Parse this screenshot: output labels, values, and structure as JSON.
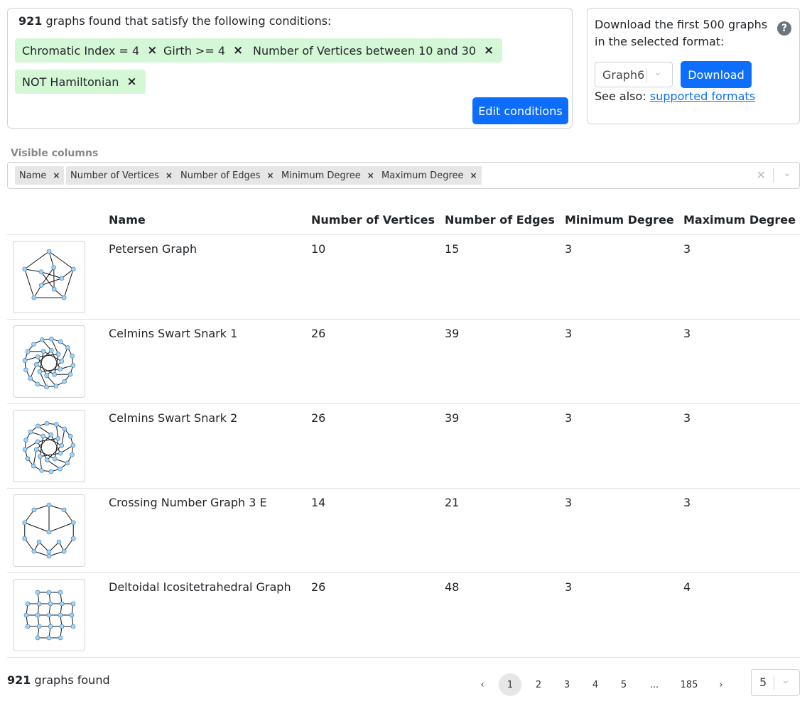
{
  "conditions": {
    "count": "921",
    "summary_suffix": "graphs found that satisfy the following conditions:",
    "chips": [
      {
        "label": "Chromatic Index = 4",
        "remove": "×"
      },
      {
        "label": "Girth >= 4",
        "remove": "×"
      },
      {
        "label": "Number of Vertices between 10 and 30",
        "remove": "×"
      },
      {
        "label": "NOT Hamiltonian",
        "remove": "×"
      }
    ],
    "edit_label": "Edit conditions"
  },
  "download": {
    "text": "Download the first 500 graphs in the selected format:",
    "help": "?",
    "format_value": "Graph6",
    "button_label": "Download",
    "see_also_prefix": "See also:",
    "see_also_link": "supported formats"
  },
  "visible_columns": {
    "label": "Visible columns",
    "chips": [
      {
        "label": "Name",
        "remove": "×"
      },
      {
        "label": "Number of Vertices",
        "remove": "×"
      },
      {
        "label": "Number of Edges",
        "remove": "×"
      },
      {
        "label": "Minimum Degree",
        "remove": "×"
      },
      {
        "label": "Maximum Degree",
        "remove": "×"
      }
    ],
    "clear": "✕"
  },
  "table": {
    "headers": [
      "Name",
      "Number of Vertices",
      "Number of Edges",
      "Minimum Degree",
      "Maximum Degree"
    ],
    "rows": [
      {
        "name": "Petersen Graph",
        "vertices": "10",
        "edges": "15",
        "min_degree": "3",
        "max_degree": "3"
      },
      {
        "name": "Celmins Swart Snark 1",
        "vertices": "26",
        "edges": "39",
        "min_degree": "3",
        "max_degree": "3"
      },
      {
        "name": "Celmins Swart Snark 2",
        "vertices": "26",
        "edges": "39",
        "min_degree": "3",
        "max_degree": "3"
      },
      {
        "name": "Crossing Number Graph 3 E",
        "vertices": "14",
        "edges": "21",
        "min_degree": "3",
        "max_degree": "3"
      },
      {
        "name": "Deltoidal Icositetrahedral Graph",
        "vertices": "26",
        "edges": "48",
        "min_degree": "3",
        "max_degree": "4"
      }
    ]
  },
  "footer": {
    "count": "921",
    "suffix": "graphs found",
    "pager": {
      "prev": "‹",
      "pages": [
        "1",
        "2",
        "3",
        "4",
        "5",
        "...",
        "185"
      ],
      "active": "1",
      "next": "›"
    },
    "per_page": "5"
  },
  "colors": {
    "accent": "#0d6efd",
    "chip_green": "#d4f8d6",
    "vertex": "#9fd3f7"
  }
}
